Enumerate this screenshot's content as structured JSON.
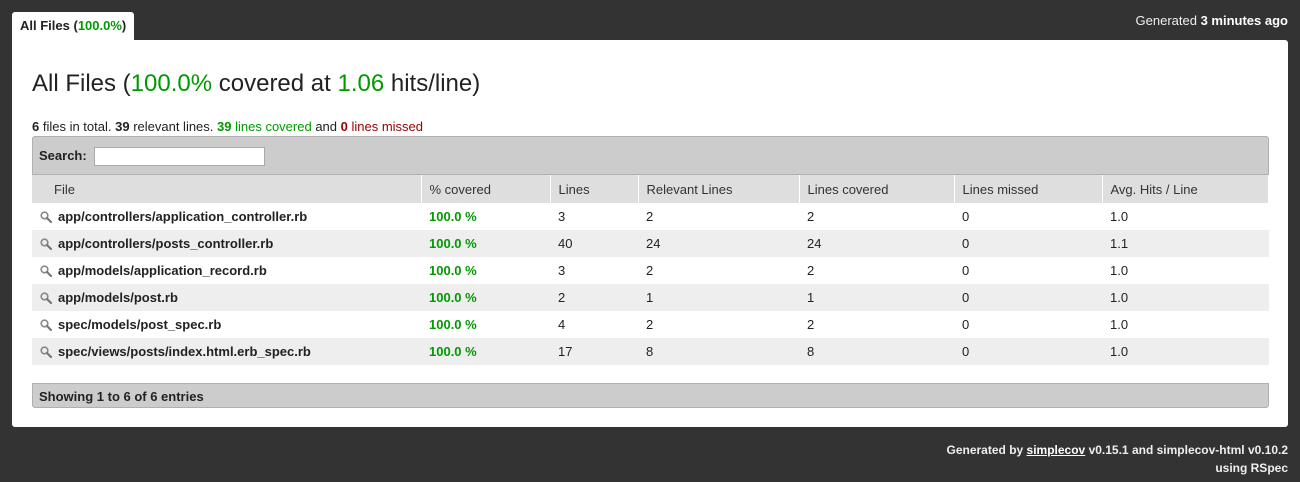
{
  "tab": {
    "label": "All Files",
    "percent": "100.0%"
  },
  "generated": {
    "prefix": "Generated",
    "time": "3 minutes ago"
  },
  "heading": {
    "prefix": "All Files (",
    "percent": "100.0%",
    "middle": " covered at ",
    "hits": "1.06",
    "suffix": " hits/line)"
  },
  "summary": {
    "files_count": "6",
    "files_text": " files in total. ",
    "relevant_count": "39",
    "relevant_text": " relevant lines. ",
    "covered_count": "39",
    "covered_text": " lines covered",
    "and_text": " and ",
    "missed_count": "0",
    "missed_text": " lines missed"
  },
  "search": {
    "label": "Search:",
    "value": ""
  },
  "table": {
    "headers": [
      "File",
      "% covered",
      "Lines",
      "Relevant Lines",
      "Lines covered",
      "Lines missed",
      "Avg. Hits / Line"
    ],
    "rows": [
      {
        "file": "app/controllers/application_controller.rb",
        "covered": "100.0 %",
        "lines": "3",
        "relevant": "2",
        "lines_covered": "2",
        "missed": "0",
        "avg": "1.0"
      },
      {
        "file": "app/controllers/posts_controller.rb",
        "covered": "100.0 %",
        "lines": "40",
        "relevant": "24",
        "lines_covered": "24",
        "missed": "0",
        "avg": "1.1"
      },
      {
        "file": "app/models/application_record.rb",
        "covered": "100.0 %",
        "lines": "3",
        "relevant": "2",
        "lines_covered": "2",
        "missed": "0",
        "avg": "1.0"
      },
      {
        "file": "app/models/post.rb",
        "covered": "100.0 %",
        "lines": "2",
        "relevant": "1",
        "lines_covered": "1",
        "missed": "0",
        "avg": "1.0"
      },
      {
        "file": "spec/models/post_spec.rb",
        "covered": "100.0 %",
        "lines": "4",
        "relevant": "2",
        "lines_covered": "2",
        "missed": "0",
        "avg": "1.0"
      },
      {
        "file": "spec/views/posts/index.html.erb_spec.rb",
        "covered": "100.0 %",
        "lines": "17",
        "relevant": "8",
        "lines_covered": "8",
        "missed": "0",
        "avg": "1.0"
      }
    ]
  },
  "pagination": {
    "info": "Showing 1 to 6 of 6 entries"
  },
  "credits": {
    "prefix": "Generated by ",
    "tool": "simplecov",
    "middle": " v0.15.1 and simplecov-html v0.10.2",
    "line2": "using RSpec"
  },
  "colors": {
    "background": "#333333",
    "good": "#009a00",
    "bad": "#990000"
  },
  "icons": {
    "file_row": "magnifier-icon"
  }
}
